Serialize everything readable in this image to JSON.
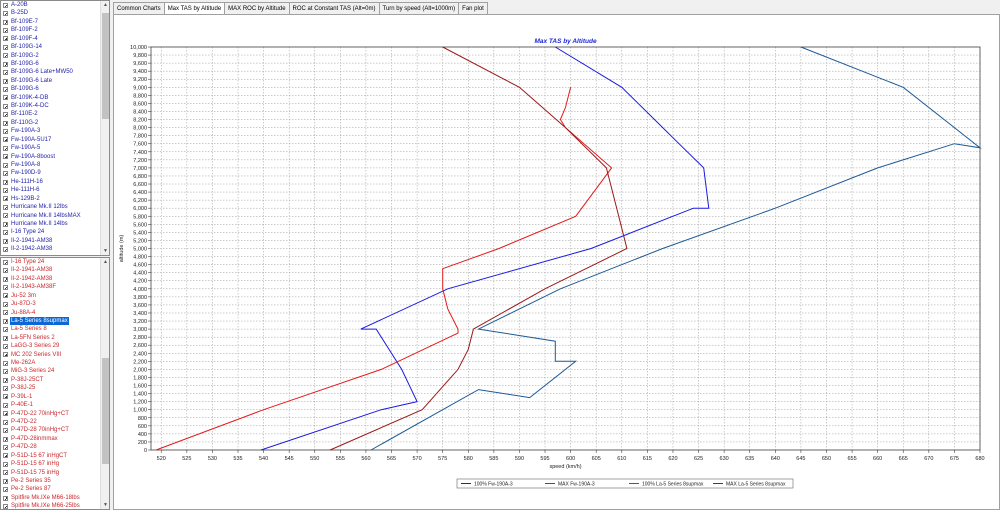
{
  "sidebar_top": {
    "items": [
      "A-20B",
      "B-25D",
      "Bf-109E-7",
      "Bf-109F-2",
      "Bf-109F-4",
      "Bf-109G-14",
      "Bf-109G-2",
      "Bf-109G-6",
      "Bf-109G-6 Late+MW50",
      "Bf-109G-6 Late",
      "Bf-109G-6",
      "Bf-109K-4-DB",
      "Bf-109K-4-DC",
      "Bf-110E-2",
      "Bf-110G-2",
      "Fw-190A-3",
      "Fw-190A-5U17",
      "Fw-190A-5",
      "Fw-190A-8boost",
      "Fw-190A-8",
      "Fw-190D-9",
      "He-111H-16",
      "He-111H-6",
      "Hs-129B-2",
      "Hurricane Mk.II 12lbs",
      "Hurricane Mk.II 14lbsMAX",
      "Hurricane Mk.II 14lbs",
      "I-16 Type 24",
      "Il-2-1941-AM38",
      "Il-2-1942-AM38"
    ]
  },
  "sidebar_bottom": {
    "items": [
      "I-16 Type 24",
      "Il-2-1941-AM38",
      "Il-2-1942-AM38",
      "Il-2-1943-AM38F",
      "Ju-52 3m",
      "Ju-87D-3",
      "Ju-88A-4",
      "La-5 Series 8supmax",
      "La-5 Series 8",
      "La-5FN Series 2",
      "LaGG-3 Series 29",
      "MC 202 Series VIII",
      "Me-262A",
      "MiG-3 Series 24",
      "P-38J-25CT",
      "P-38J-25",
      "P-39L-1",
      "P-40E-1",
      "P-47D-22 70inHg+CT",
      "P-47D-22",
      "P-47D-28 70inHg+CT",
      "P-47D-28inmmax",
      "P-47D-28",
      "P-51D-15 67 inHgCT",
      "P-51D-15 67 inHg",
      "P-51D-15 75 inHg",
      "Pe-2 Series 35",
      "Pe-2 Series 87",
      "Spitfire Mk.IXe M66-18lbs",
      "Spitfire Mk.IXe M66-25lbs"
    ],
    "selected_index": 7
  },
  "tabs": [
    "Common Charts",
    "Max TAS by Altitude",
    "MAX ROC by Altitude",
    "ROC at Constant TAS (Alt=0m)",
    "Turn by speed (Alt=1000m)",
    "Fan plot"
  ],
  "active_tab_index": 1,
  "icons": {
    "expander": "plus-box-icon",
    "scroll_up": "triangle-up-icon",
    "scroll_down": "triangle-down-icon"
  },
  "chart_data": {
    "type": "line",
    "title": "Max TAS by Altitude",
    "xlabel": "speed (km/h)",
    "ylabel": "altitude (m)",
    "xlim": [
      518,
      680
    ],
    "ylim": [
      0,
      10000
    ],
    "x_ticks": [
      520,
      525,
      530,
      535,
      540,
      545,
      550,
      555,
      560,
      565,
      570,
      575,
      580,
      585,
      590,
      595,
      600,
      605,
      610,
      615,
      620,
      625,
      630,
      635,
      640,
      645,
      650,
      655,
      660,
      665,
      670,
      675,
      680
    ],
    "y_ticks": [
      0,
      200,
      400,
      600,
      800,
      1000,
      1200,
      1400,
      1600,
      1800,
      2000,
      2200,
      2400,
      2600,
      2800,
      3000,
      3200,
      3400,
      3600,
      3800,
      4000,
      4200,
      4400,
      4600,
      4800,
      5000,
      5200,
      5400,
      5600,
      5800,
      6000,
      6200,
      6400,
      6600,
      6800,
      7000,
      7200,
      7400,
      7600,
      7800,
      8000,
      8200,
      8400,
      8600,
      8800,
      9000,
      9200,
      9400,
      9600,
      9800,
      10000
    ],
    "y_tick_labels": [
      "0",
      "200",
      "400",
      "600",
      "800",
      "1,000",
      "1,200",
      "1,400",
      "1,600",
      "1,800",
      "2,000",
      "2,200",
      "2,400",
      "2,600",
      "2,800",
      "3,000",
      "3,200",
      "3,400",
      "3,600",
      "3,800",
      "4,000",
      "4,200",
      "4,400",
      "4,600",
      "4,800",
      "5,000",
      "5,200",
      "5,400",
      "5,600",
      "5,800",
      "6,000",
      "6,200",
      "6,400",
      "6,600",
      "6,800",
      "7,000",
      "7,200",
      "7,400",
      "7,600",
      "7,800",
      "8,000",
      "8,200",
      "8,400",
      "8,600",
      "8,800",
      "9,000",
      "9,200",
      "9,400",
      "9,600",
      "9,800",
      "10,000"
    ],
    "grid": true,
    "legend_position": "bottom",
    "series": [
      {
        "name": "100% Fw-190A-3",
        "color": "#1a1ae0",
        "x": [
          539.5,
          563,
          570,
          567,
          562,
          559,
          576,
          604,
          624,
          627,
          626,
          622,
          610,
          597
        ],
        "y": [
          0,
          1000,
          1200,
          2000,
          3000,
          3000,
          4000,
          5000,
          6000,
          6000,
          7000,
          7500,
          9000,
          10000
        ]
      },
      {
        "name": "MAX Fw-190A-3",
        "color": "#1e5a96",
        "x": [
          561,
          575,
          582,
          592,
          601,
          597,
          597,
          582,
          582,
          598,
          618,
          640,
          660,
          675,
          680,
          675,
          665,
          645
        ],
        "y": [
          0,
          1000,
          1500,
          1300,
          2200,
          2200,
          2700,
          3000,
          3000,
          4000,
          5000,
          6000,
          7000,
          7600,
          7500,
          8000,
          9000,
          10000
        ]
      },
      {
        "name": "100% La-5 Series 8supmax",
        "color": "#e21a1a",
        "x": [
          519,
          540,
          563,
          578,
          578,
          576,
          575,
          575,
          586,
          601,
          608,
          599,
          598,
          599,
          600
        ],
        "y": [
          0,
          1000,
          2000,
          2900,
          3000,
          3500,
          4000,
          4500,
          5000,
          5800,
          7000,
          8000,
          8200,
          8500,
          9000
        ]
      },
      {
        "name": "MAX La-5 Series 8supmax",
        "color": "#9a1a1a",
        "x": [
          553,
          571,
          578,
          580,
          581,
          595,
          611,
          609,
          607,
          599,
          590,
          575
        ],
        "y": [
          0,
          1000,
          2000,
          2500,
          3000,
          4000,
          5000,
          6000,
          7000,
          8000,
          9000,
          10000
        ]
      }
    ]
  }
}
